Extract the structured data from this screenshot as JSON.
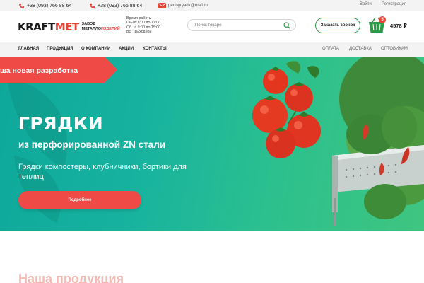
{
  "topbar": {
    "phone1": "+38 (093) 766 88 64",
    "phone2": "+38 (093) 766 88 64",
    "email": "perfogryadk@mail.ru",
    "login": "Войти",
    "register": "Регистрация"
  },
  "header": {
    "logo_main_dark": "KRAFT",
    "logo_main_red": "MET",
    "logo_sub_line1": "Завод",
    "logo_sub_line2_dark": "металло",
    "logo_sub_line2_red": "изделий",
    "hours_title": "Время работы",
    "hours": [
      {
        "day": "Пн-Пт",
        "time": "с 8:00 до 17:00"
      },
      {
        "day": "Сб",
        "time": "с 9:00 до 15:00"
      },
      {
        "day": "Вс",
        "time": "выходной"
      }
    ],
    "search_placeholder": "Поиск товаро",
    "callback_label": "Заказать звонок",
    "cart_count": "5",
    "cart_total": "4578 ₽"
  },
  "nav": {
    "left": [
      "ГЛАВНАЯ",
      "ПРОДУКЦИЯ",
      "О КОМПАНИИ",
      "АКЦИИ",
      "КОНТАКТЫ"
    ],
    "right": [
      "ОПЛАТА",
      "ДОСТАВКА",
      "ОПТОВИКАМ"
    ]
  },
  "hero": {
    "ribbon": "ша новая разработка",
    "title": "ГРЯДКИ",
    "subtitle": "из перфорированной ZN стали",
    "description": "Грядки компостеры, клубничники, бортики для теплиц",
    "button": "Подробнее"
  },
  "section": {
    "title": "Наша продукция"
  },
  "colors": {
    "accent_red": "#e8443a",
    "accent_green": "#2d9a45",
    "hero_bg": "#17b39f",
    "button_red": "#ef4a45"
  }
}
